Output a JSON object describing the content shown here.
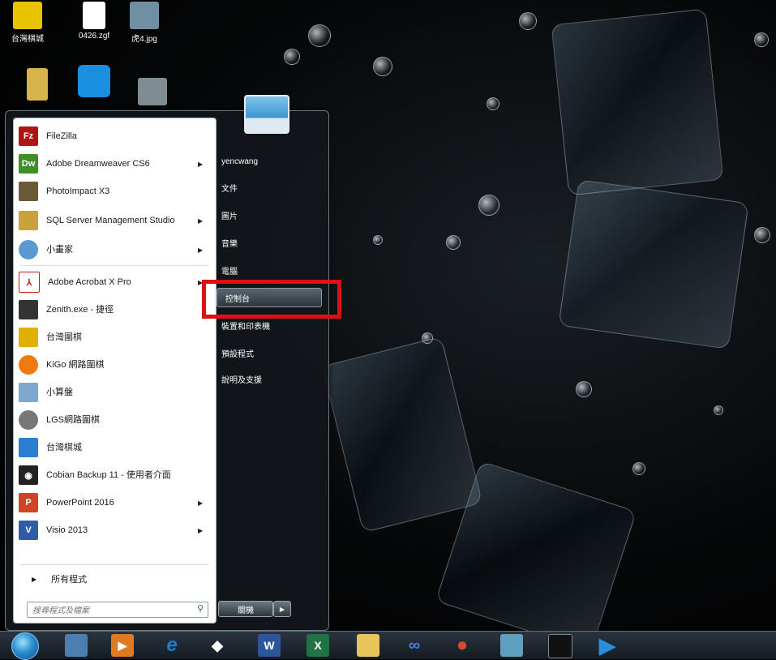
{
  "desktop": {
    "icons": [
      {
        "label": "台灣棋城",
        "color": "#e8c400"
      },
      {
        "label": "0426.zgf",
        "color": "#ffffff"
      },
      {
        "label": "虎4.jpg",
        "color": "#6f8fa3"
      },
      {
        "label": "",
        "color": "#d7b44a"
      },
      {
        "label": "",
        "color": "#1a8fe0"
      },
      {
        "label": "",
        "color": "#7f8c93"
      }
    ]
  },
  "start_menu": {
    "programs": [
      {
        "label": "FileZilla",
        "icon": "filezilla-icon",
        "color": "#b01515",
        "glyph": "Fz",
        "submenu": false
      },
      {
        "label": "Adobe Dreamweaver CS6",
        "icon": "dreamweaver-icon",
        "color": "#3f8f2a",
        "glyph": "Dw",
        "submenu": true
      },
      {
        "label": "PhotoImpact X3",
        "icon": "photoimpact-icon",
        "color": "#6a5a3a",
        "glyph": "",
        "submenu": false
      },
      {
        "label": "SQL Server Management Studio",
        "icon": "sql-server-icon",
        "color": "#c9a23a",
        "glyph": "",
        "submenu": true
      },
      {
        "label": "小畫家",
        "icon": "paint-icon",
        "color": "#5a9ad0",
        "glyph": "",
        "submenu": true
      },
      {
        "label": "Adobe Acrobat X Pro",
        "icon": "acrobat-icon",
        "color": "#c41a1a",
        "glyph": "",
        "submenu": true
      },
      {
        "label": "Zenith.exe - 捷徑",
        "icon": "zenith-icon",
        "color": "#333333",
        "glyph": "",
        "submenu": false
      },
      {
        "label": "台灣圍棋",
        "icon": "taiwan-go-icon",
        "color": "#e0b000",
        "glyph": "",
        "submenu": false
      },
      {
        "label": "KiGo 網路圍棋",
        "icon": "kigo-icon",
        "color": "#f07a10",
        "glyph": "",
        "submenu": false
      },
      {
        "label": "小算盤",
        "icon": "calculator-icon",
        "color": "#7fa8d0",
        "glyph": "",
        "submenu": false
      },
      {
        "label": "LGS網路圍棋",
        "icon": "lgs-icon",
        "color": "#777777",
        "glyph": "",
        "submenu": false
      },
      {
        "label": "台灣棋城",
        "icon": "taiwan-chess-icon",
        "color": "#2a7fd0",
        "glyph": "",
        "submenu": false
      },
      {
        "label": "Cobian Backup 11 - 使用者介面",
        "icon": "cobian-backup-icon",
        "color": "#222222",
        "glyph": "",
        "submenu": false
      },
      {
        "label": "PowerPoint 2016",
        "icon": "powerpoint-icon",
        "color": "#d04423",
        "glyph": "P",
        "submenu": true
      },
      {
        "label": "Visio 2013",
        "icon": "visio-icon",
        "color": "#2f5ca8",
        "glyph": "V",
        "submenu": true
      }
    ],
    "all_programs": "所有程式",
    "search_placeholder": "搜尋程式及檔案",
    "right_items": [
      "yencwang",
      "文件",
      "圖片",
      "音樂",
      "電腦",
      "控制台",
      "裝置和印表機",
      "預設程式",
      "說明及支援"
    ],
    "highlighted_item": "控制台",
    "shutdown": "關機",
    "highlight_color": "#e01010"
  },
  "taskbar": {
    "items": [
      {
        "name": "network-icon",
        "color": "#4a7fb0",
        "glyph": ""
      },
      {
        "name": "media-player-icon",
        "color": "#e07a20",
        "glyph": "▶"
      },
      {
        "name": "internet-explorer-icon",
        "color": "#1a7fd0",
        "glyph": "e"
      },
      {
        "name": "virtualbox-icon",
        "color": "#ffffff",
        "glyph": "◆"
      },
      {
        "name": "word-icon",
        "color": "#2b579a",
        "glyph": "W"
      },
      {
        "name": "excel-icon",
        "color": "#217346",
        "glyph": "X"
      },
      {
        "name": "explorer-icon",
        "color": "#e8c45a",
        "glyph": ""
      },
      {
        "name": "link-icon",
        "color": "#2a4fa0",
        "glyph": "∞"
      },
      {
        "name": "chrome-icon",
        "color": "#d84a30",
        "glyph": "●"
      },
      {
        "name": "app-icon",
        "color": "#5fa0c0",
        "glyph": ""
      },
      {
        "name": "terminal-icon",
        "color": "#111111",
        "glyph": ""
      },
      {
        "name": "play-icon",
        "color": "#2a8fd8",
        "glyph": "▶"
      }
    ]
  }
}
